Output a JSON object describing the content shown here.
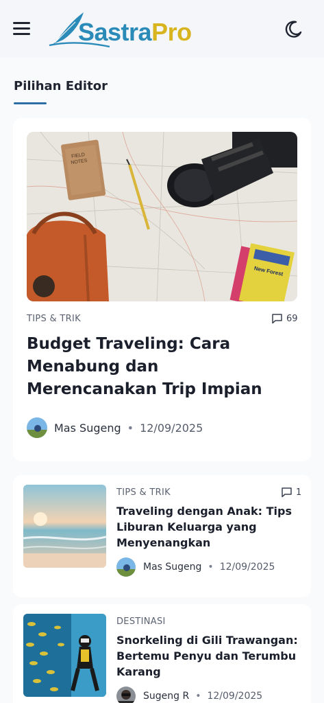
{
  "header": {
    "logo_part1": "Sastra",
    "logo_part2": "Pro",
    "menu_icon": "hamburger-menu-icon",
    "theme_icon": "moon-icon"
  },
  "section": {
    "title": "Pilihan Editor"
  },
  "featured": {
    "category": "TIPS & TRIK",
    "comments": "69",
    "title": "Budget Traveling: Cara Menabung dan Merencanakan Trip Impian",
    "author": "Mas Sugeng",
    "date": "12/09/2025",
    "image": "travel-map-flatlay"
  },
  "articles": [
    {
      "category": "TIPS & TRIK",
      "comments": "1",
      "title": "Traveling dengan Anak: Tips Liburan Keluarga yang Menyenangkan",
      "author": "Mas Sugeng",
      "date": "12/09/2025",
      "image": "beach-sunset"
    },
    {
      "category": "DESTINASI",
      "title": "Snorkeling di Gili Trawangan: Bertemu Penyu dan Terumbu Karang",
      "author": "Sugeng R",
      "date": "12/09/2025",
      "image": "underwater-diver"
    }
  ],
  "colors": {
    "brand_blue": "#2a8ab8",
    "brand_yellow": "#d8b41e",
    "accent_underline": "#2c6ea5"
  }
}
